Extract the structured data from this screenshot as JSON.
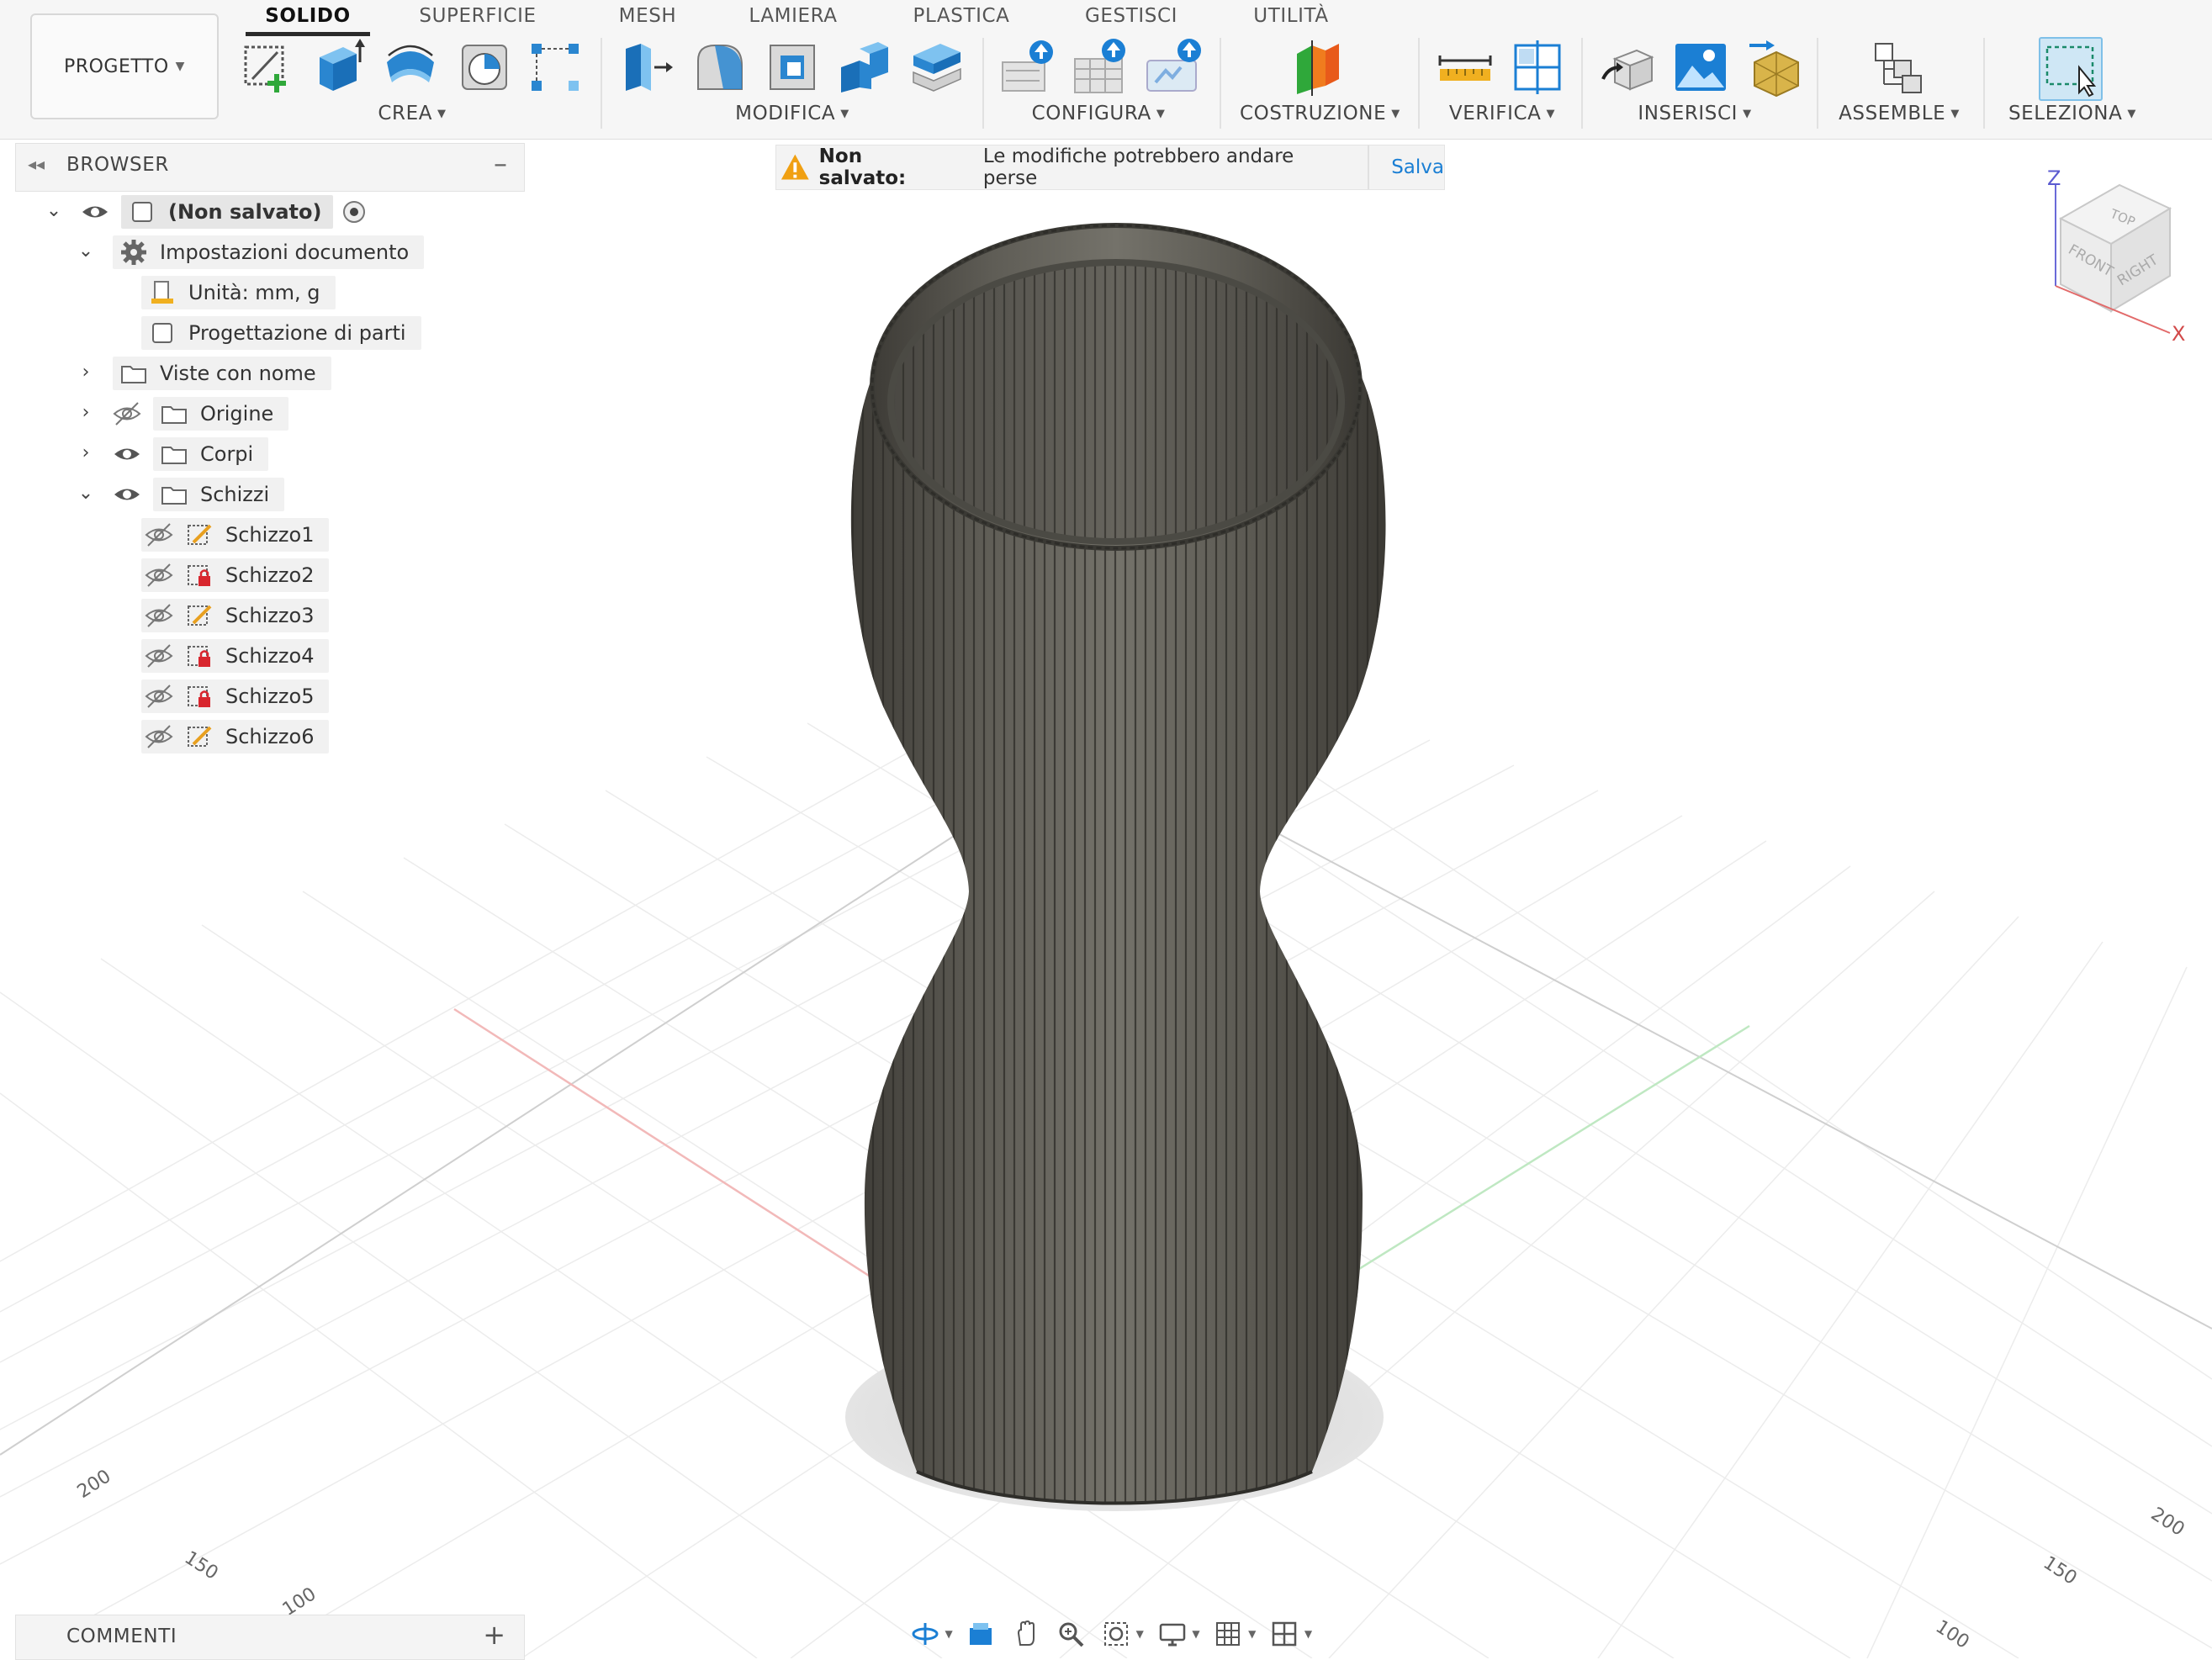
{
  "toolbar": {
    "project_label": "PROGETTO",
    "tabs": [
      "SOLIDO",
      "SUPERFICIE",
      "MESH",
      "LAMIERA",
      "PLASTICA",
      "GESTISCI",
      "UTILITÀ"
    ],
    "active_tab": "SOLIDO",
    "groups": {
      "crea": "CREA",
      "modifica": "MODIFICA",
      "configura": "CONFIGURA",
      "costruzione": "COSTRUZIONE",
      "verifica": "VERIFICA",
      "inserisci": "INSERISCI",
      "assemble": "ASSEMBLE",
      "seleziona": "SELEZIONA"
    },
    "accent": "#1b7fd4"
  },
  "browser": {
    "title": "BROWSER",
    "root": "(Non salvato)",
    "doc_settings": "Impostazioni documento",
    "units": "Unità: mm, g",
    "design_type": "Progettazione di parti",
    "named_views": "Viste con nome",
    "origin": "Origine",
    "bodies": "Corpi",
    "sketches": "Schizzi",
    "sketch_items": [
      "Schizzo1",
      "Schizzo2",
      "Schizzo3",
      "Schizzo4",
      "Schizzo5",
      "Schizzo6"
    ],
    "sketch_locked": [
      false,
      true,
      false,
      true,
      true,
      false
    ]
  },
  "warning": {
    "label": "Non salvato:",
    "message": "Le modifiche potrebbero andare perse",
    "action": "Salva",
    "icon": "warning-triangle-icon",
    "color": "#f0a012"
  },
  "viewcube": {
    "top": "TOP",
    "front": "FRONT",
    "right": "RIGHT",
    "axis_z": "Z",
    "axis_x": "X"
  },
  "grid": {
    "left_labels": [
      "200",
      "150",
      "100"
    ],
    "right_labels": [
      "200",
      "150",
      "100"
    ]
  },
  "comments": {
    "title": "COMMENTI"
  },
  "model": {
    "color": "#5a5852"
  }
}
